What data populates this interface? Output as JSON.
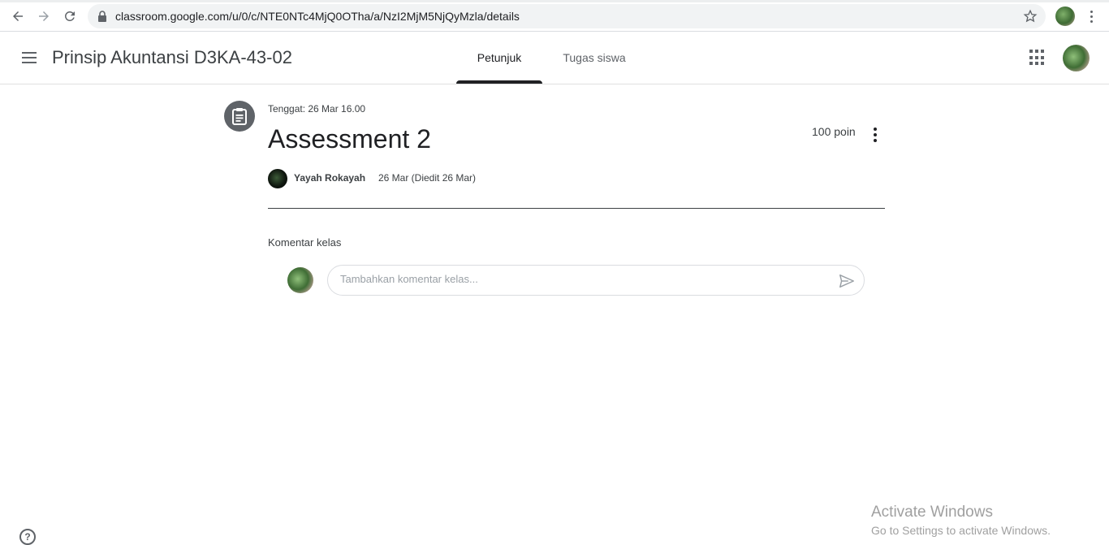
{
  "browser": {
    "url": "classroom.google.com/u/0/c/NTE0NTc4MjQ0OTha/a/NzI2MjM5NjQyMzla/details"
  },
  "header": {
    "class_title": "Prinsip Akuntansi D3KA-43-02",
    "tabs": [
      {
        "label": "Petunjuk",
        "active": true
      },
      {
        "label": "Tugas siswa",
        "active": false
      }
    ]
  },
  "assignment": {
    "due": "Tenggat: 26 Mar 16.00",
    "title": "Assessment 2",
    "points": "100 poin",
    "author": "Yayah Rokayah",
    "posted": "26 Mar (Diedit 26 Mar)"
  },
  "comments": {
    "heading": "Komentar kelas",
    "placeholder": "Tambahkan komentar kelas..."
  },
  "help": {
    "label": "?"
  },
  "watermark": {
    "line1": "Activate Windows",
    "line2": "Go to Settings to activate Windows."
  }
}
